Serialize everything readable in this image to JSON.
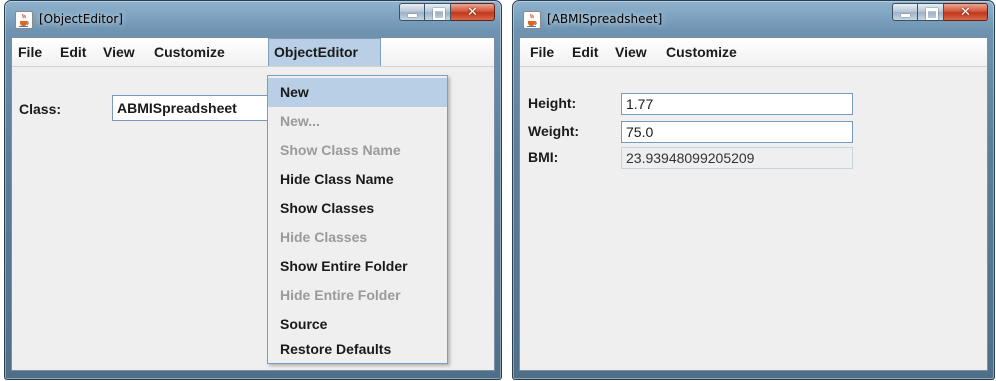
{
  "windows": [
    {
      "title": "[ObjectEditor]",
      "menu": [
        "File",
        "Edit",
        "View",
        "Customize",
        "ObjectEditor"
      ],
      "form": {
        "class_label": "Class:",
        "class_value": "ABMISpreadsheet"
      },
      "dropdown": {
        "items": [
          {
            "label": "New",
            "enabled": true,
            "highlighted": true
          },
          {
            "label": "New...",
            "enabled": false
          },
          {
            "label": "Show Class Name",
            "enabled": false
          },
          {
            "label": "Hide Class Name",
            "enabled": true
          },
          {
            "label": "Show Classes",
            "enabled": true
          },
          {
            "label": "Hide Classes",
            "enabled": false
          },
          {
            "label": "Show Entire Folder",
            "enabled": true
          },
          {
            "label": "Hide Entire Folder",
            "enabled": false
          },
          {
            "label": "Source",
            "enabled": true
          },
          {
            "label": "Restore Defaults",
            "enabled": true
          }
        ]
      }
    },
    {
      "title": "[ABMISpreadsheet]",
      "menu": [
        "File",
        "Edit",
        "View",
        "Customize"
      ],
      "fields": [
        {
          "label": "Height:",
          "value": "1.77",
          "editable": true
        },
        {
          "label": "Weight:",
          "value": "75.0",
          "editable": true
        },
        {
          "label": "BMI:",
          "value": "23.93948099205209",
          "editable": false
        }
      ]
    }
  ],
  "colors": {
    "menu_highlight": "#b8cfe5",
    "disabled_text": "#9a9a9a",
    "close_button": "#c2381c"
  },
  "icons": [
    "java-cup-icon",
    "minimize-icon",
    "maximize-icon",
    "close-icon"
  ]
}
